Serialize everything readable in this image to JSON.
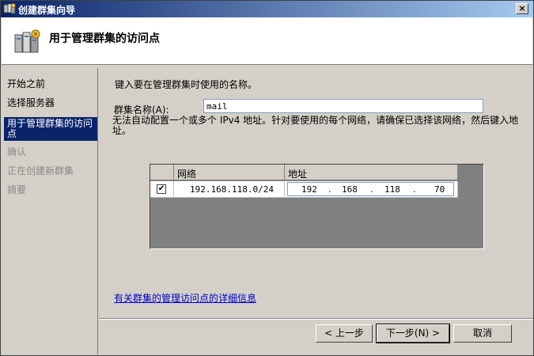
{
  "window": {
    "title": "创建群集向导"
  },
  "header": {
    "title": "用于管理群集的访问点"
  },
  "sidebar": {
    "steps": [
      {
        "label": "开始之前",
        "state": "normal"
      },
      {
        "label": "选择服务器",
        "state": "normal"
      },
      {
        "label": "用于管理群集的访问点",
        "state": "active"
      },
      {
        "label": "确认",
        "state": "disabled"
      },
      {
        "label": "正在创建新群集",
        "state": "disabled"
      },
      {
        "label": "摘要",
        "state": "disabled"
      }
    ]
  },
  "main": {
    "intro": "键入要在管理群集时使用的名称。",
    "cluster_name_label": "群集名称(A):",
    "cluster_name_value": "mail",
    "note": "无法自动配置一个或多个 IPv4 地址。针对要使用的每个网络，请确保已选择该网络，然后键入地址。",
    "grid": {
      "columns": [
        "",
        "网络",
        "地址"
      ],
      "rows": [
        {
          "checked": true,
          "check_glyph": "✔",
          "network": "192.168.118.0/24",
          "address": [
            "192",
            "168",
            "118",
            "70"
          ]
        }
      ]
    },
    "more_info_link": "有关群集的管理访问点的详细信息"
  },
  "buttons": {
    "back": "< 上一步",
    "next": "下一步(N) >",
    "cancel": "取消"
  },
  "close_glyph": "×",
  "colors": {
    "title_start": "#0a246a",
    "title_end": "#a6caf0",
    "active_step": "#0a246a",
    "link": "#0000cc"
  }
}
